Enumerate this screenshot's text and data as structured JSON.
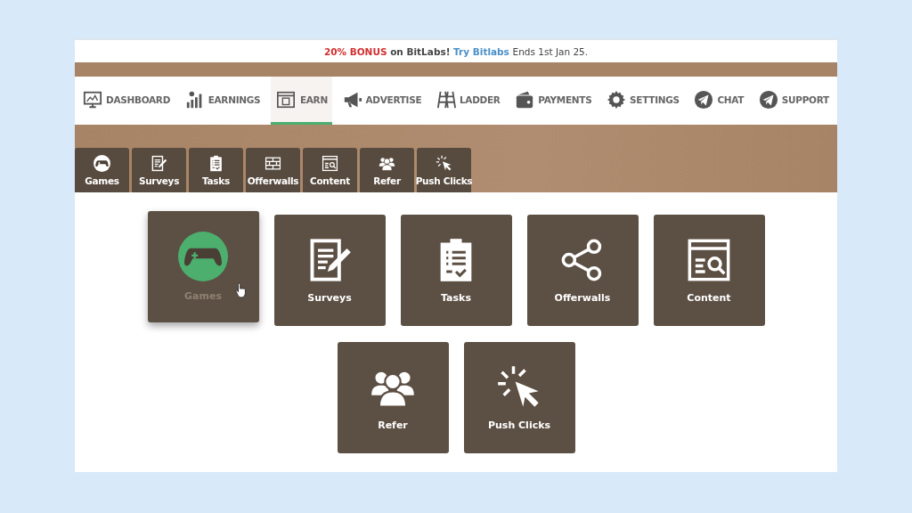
{
  "banner": {
    "highlight": "20% BONUS",
    "text": "on BitLabs!",
    "link": "Try Bitlabs",
    "tail": "Ends 1st Jan 25."
  },
  "nav": [
    {
      "label": "DASHBOARD",
      "selected": false
    },
    {
      "label": "EARNINGS",
      "selected": false
    },
    {
      "label": "EARN",
      "selected": true
    },
    {
      "label": "ADVERTISE",
      "selected": false
    },
    {
      "label": "LADDER",
      "selected": false
    },
    {
      "label": "PAYMENTS",
      "selected": false
    },
    {
      "label": "SETTINGS",
      "selected": false
    },
    {
      "label": "CHAT",
      "selected": false
    },
    {
      "label": "SUPPORT",
      "selected": false
    }
  ],
  "subtabs": [
    {
      "label": "Games"
    },
    {
      "label": "Surveys"
    },
    {
      "label": "Tasks"
    },
    {
      "label": "Offerwalls"
    },
    {
      "label": "Content"
    },
    {
      "label": "Refer"
    },
    {
      "label": "Push Clicks"
    }
  ],
  "tiles": [
    {
      "label": "Games",
      "hovered": true
    },
    {
      "label": "Surveys",
      "hovered": false
    },
    {
      "label": "Tasks",
      "hovered": false
    },
    {
      "label": "Offerwalls",
      "hovered": false
    },
    {
      "label": "Content",
      "hovered": false
    },
    {
      "label": "Refer",
      "hovered": false
    },
    {
      "label": "Push Clicks",
      "hovered": false
    }
  ]
}
